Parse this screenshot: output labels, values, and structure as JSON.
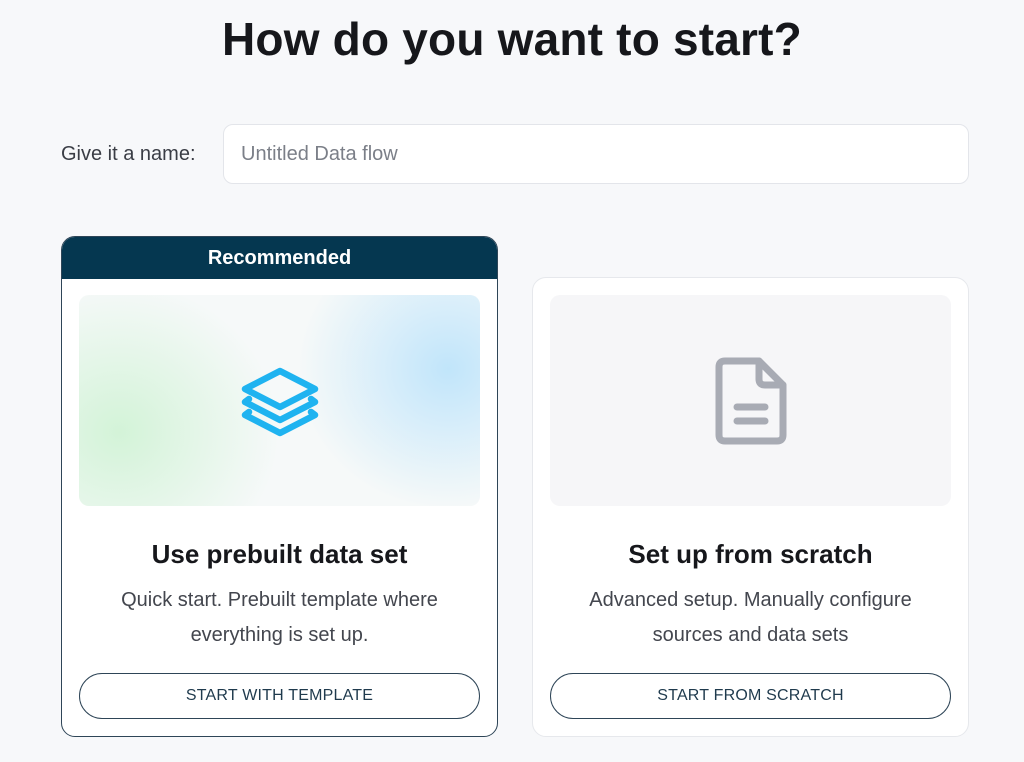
{
  "page": {
    "title": "How do you want to start?"
  },
  "name_field": {
    "label": "Give it a name:",
    "placeholder": "Untitled Data flow",
    "value": ""
  },
  "cards": [
    {
      "badge": "Recommended",
      "icon": "layers-icon",
      "title": "Use prebuilt data set",
      "description": "Quick start. Prebuilt template where everything is set up.",
      "button_label": "START WITH TEMPLATE"
    },
    {
      "icon": "document-icon",
      "title": "Set up from scratch",
      "description": "Advanced setup. Manually configure sources and data sets",
      "button_label": "START FROM SCRATCH"
    }
  ],
  "colors": {
    "banner_bg": "#053750",
    "accent_icon": "#1fb3f0",
    "muted_icon": "#a8abb4",
    "button_border": "#2e4557"
  }
}
